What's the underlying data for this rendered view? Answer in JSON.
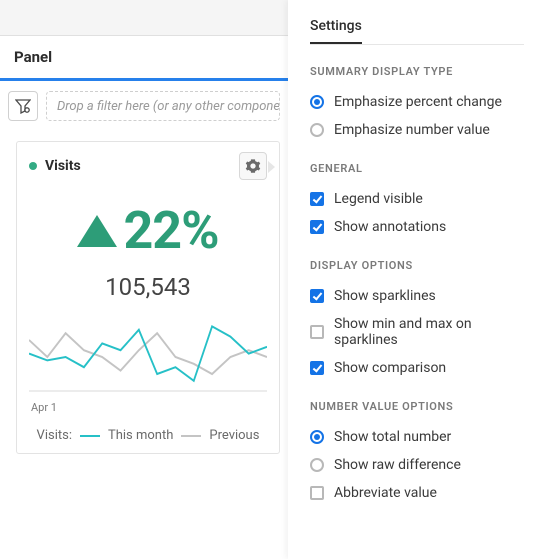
{
  "panel": {
    "title": "Panel",
    "filter_placeholder": "Drop a filter here (or any other compone"
  },
  "viz": {
    "title": "Visits",
    "percent_change": "22%",
    "number_value": "105,543",
    "x_axis_label": "Apr 1",
    "legend_prefix": "Visits:",
    "series_current": "This month",
    "series_previous": "Previous"
  },
  "chart_data": {
    "type": "line",
    "x": [
      0,
      1,
      2,
      3,
      4,
      5,
      6,
      7,
      8,
      9,
      10,
      11,
      12,
      13
    ],
    "series": [
      {
        "name": "This month",
        "color": "#26c0c7",
        "values": [
          42,
          38,
          40,
          34,
          48,
          44,
          56,
          30,
          34,
          26,
          58,
          52,
          42,
          46
        ]
      },
      {
        "name": "Previous",
        "color": "#c4c4c4",
        "values": [
          50,
          40,
          54,
          44,
          40,
          32,
          44,
          54,
          40,
          36,
          30,
          40,
          44,
          40
        ]
      }
    ],
    "ylim": [
      20,
      60
    ]
  },
  "settings": {
    "tab_label": "Settings",
    "sections": {
      "summary_display_type": {
        "label": "SUMMARY DISPLAY TYPE",
        "opts": [
          {
            "label": "Emphasize percent change",
            "checked": true
          },
          {
            "label": "Emphasize number value",
            "checked": false
          }
        ]
      },
      "general": {
        "label": "GENERAL",
        "opts": [
          {
            "label": "Legend visible",
            "checked": true
          },
          {
            "label": "Show annotations",
            "checked": true
          }
        ]
      },
      "display_options": {
        "label": "DISPLAY OPTIONS",
        "opts": [
          {
            "label": "Show sparklines",
            "checked": true
          },
          {
            "label": "Show min and max on sparklines",
            "checked": false
          },
          {
            "label": "Show comparison",
            "checked": true
          }
        ]
      },
      "number_value_options": {
        "label": "NUMBER VALUE OPTIONS",
        "radio": [
          {
            "label": "Show total number",
            "checked": true
          },
          {
            "label": "Show raw difference",
            "checked": false
          }
        ],
        "check": [
          {
            "label": "Abbreviate value",
            "checked": false
          }
        ]
      }
    }
  }
}
